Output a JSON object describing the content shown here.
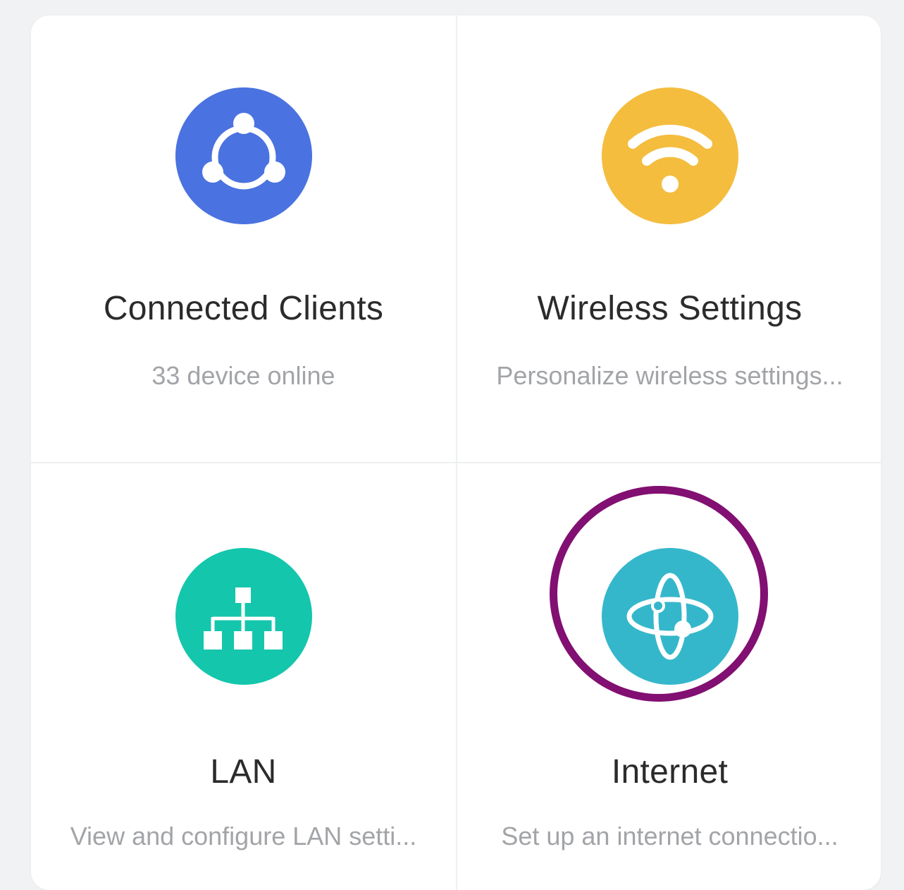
{
  "tiles": {
    "connected_clients": {
      "title": "Connected Clients",
      "subtitle": "33 device online",
      "icon": "connected-clients-icon",
      "color": "#4a72e0"
    },
    "wireless_settings": {
      "title": "Wireless Settings",
      "subtitle": "Personalize wireless settings...",
      "icon": "wifi-icon",
      "color": "#f4bd3e"
    },
    "lan": {
      "title": "LAN",
      "subtitle": "View and configure LAN setti...",
      "icon": "network-topology-icon",
      "color": "#14c6ac"
    },
    "internet": {
      "title": "Internet",
      "subtitle": "Set up an internet connectio...",
      "icon": "internet-orbit-icon",
      "color": "#35b7cb",
      "highlighted": true
    }
  },
  "highlight_color": "#820f72"
}
